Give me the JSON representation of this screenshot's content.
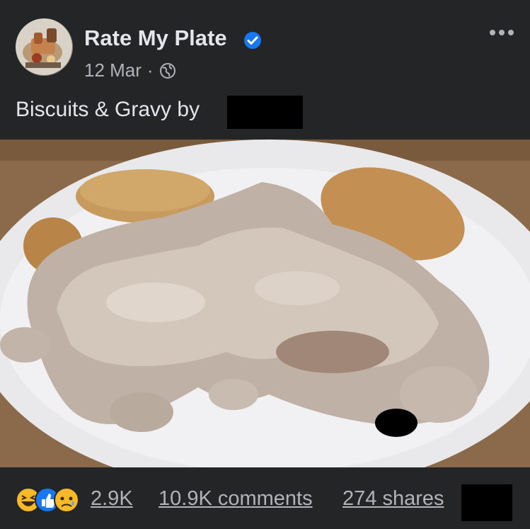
{
  "post": {
    "page_name": "Rate My Plate",
    "date": "12 Mar",
    "separator": "·",
    "caption": "Biscuits & Gravy by",
    "icons": {
      "verified": "verified-badge-icon",
      "privacy": "globe-icon",
      "more": "more-options-icon"
    }
  },
  "footer": {
    "reactions": [
      "laugh-reaction-icon",
      "like-reaction-icon",
      "sad-reaction-icon"
    ],
    "reaction_count": "2.9K",
    "comments": "10.9K comments",
    "shares": "274 shares"
  },
  "colors": {
    "background": "#242526",
    "text": "#e4e6eb",
    "secondary": "#b0b3b8",
    "verified": "#1877f2",
    "like": "#1877f2",
    "reaction_yellow": "#f7b928"
  }
}
